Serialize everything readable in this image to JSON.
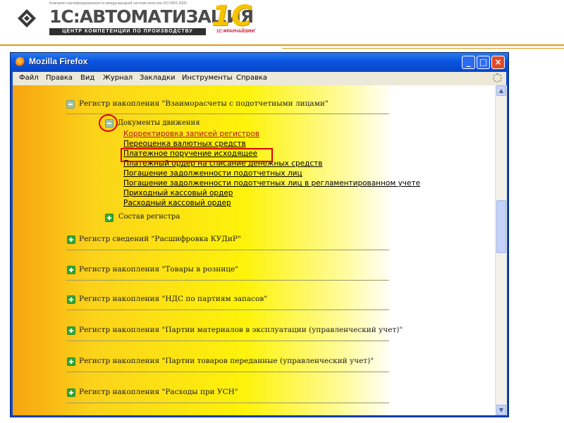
{
  "header": {
    "logo_main": "1С:АВТОМАТИЗАЦИЯ",
    "logo_tiny": "Компания сертифицированная по международной системе качества ISO 9001:2000",
    "logo_strip": "ЦЕНТР КОМПЕТЕНЦИИ ПО ПРОИЗВОДСТВУ",
    "logo_1c": "1С",
    "logo_franchise": "1С:ФРАНЧАЙЗИНГ"
  },
  "window": {
    "title": "Mozilla Firefox",
    "buttons": {
      "minimize": "_",
      "maximize": "□",
      "close": "×"
    }
  },
  "menu": {
    "items": [
      "Файл",
      "Правка",
      "Вид",
      "Журнал",
      "Закладки",
      "Инструменты",
      "Справка"
    ]
  },
  "content": {
    "section1": {
      "title": "Регистр накопления \"Взаиморасчеты с подотчетными лицами\""
    },
    "subsection_docs": {
      "title": "Документы движения"
    },
    "links": [
      "Корректировка записей регистров",
      "Переоценка валютных средств",
      "Платежное поручение исходящее",
      "Платежный ордер на списание денежных средств",
      "Погашение задолженности подотчетных лиц",
      "Погашение задолженности подотчетных лиц в регламентированном учете",
      "Приходный кассовый ордер",
      "Расходный кассовый ордер"
    ],
    "subsection_comp": {
      "title": "Состав регистра"
    },
    "sections": [
      "Регистр сведений \"Расшифровка КУДиР\"",
      "Регистр накопления \"Товары в рознице\"",
      "Регистр накопления \"НДС по партиям запасов\"",
      "Регистр накопления \"Партии материалов в эксплуатации (управленческий учет)\"",
      "Регистр накопления \"Партии товаров переданные (управленческий учет)\"",
      "Регистр накопления \"Расходы при УСН\""
    ]
  },
  "colors": {
    "highlight": "#e00000",
    "title_bar": "#0a54e0",
    "header_accent": "#e59a10",
    "expand_icon": "#32a832"
  }
}
